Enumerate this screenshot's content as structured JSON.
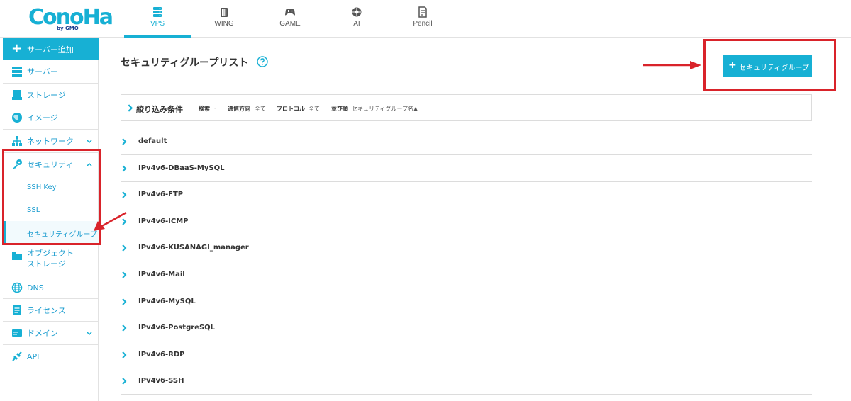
{
  "logo": {
    "text": "ConoHa",
    "sub": "by GMO"
  },
  "tabs": [
    {
      "label": "VPS",
      "icon": "server-icon",
      "active": true
    },
    {
      "label": "WING",
      "icon": "wing-icon",
      "active": false
    },
    {
      "label": "GAME",
      "icon": "gamepad-icon",
      "active": false
    },
    {
      "label": "AI",
      "icon": "ai-icon",
      "active": false
    },
    {
      "label": "Pencil",
      "icon": "pencil-icon",
      "active": false
    }
  ],
  "sidebar": {
    "add_server": "サーバー追加",
    "items": [
      {
        "label": "サーバー",
        "icon": "server-icon"
      },
      {
        "label": "ストレージ",
        "icon": "storage-icon"
      },
      {
        "label": "イメージ",
        "icon": "image-icon"
      },
      {
        "label": "ネットワーク",
        "icon": "network-icon",
        "chevron": "down"
      },
      {
        "label": "セキュリティ",
        "icon": "key-icon",
        "chevron": "up"
      },
      {
        "label": "オブジェクト",
        "label2": "ストレージ",
        "icon": "folder-icon"
      },
      {
        "label": "DNS",
        "icon": "globe-icon"
      },
      {
        "label": "ライセンス",
        "icon": "license-icon"
      },
      {
        "label": "ドメイン",
        "icon": "domain-icon",
        "chevron": "down"
      },
      {
        "label": "API",
        "icon": "api-icon"
      }
    ],
    "security_sub": [
      {
        "label": "SSH Key",
        "active": false
      },
      {
        "label": "SSL",
        "active": false
      },
      {
        "label": "セキュリティグループ",
        "active": true
      }
    ]
  },
  "main": {
    "title": "セキュリティグループリスト",
    "add_button": "セキュリティグループ",
    "filter": {
      "title": "絞り込み条件",
      "search_label": "検索",
      "search_value": "-",
      "direction_label": "通信方向",
      "direction_value": "全て",
      "protocol_label": "プロトコル",
      "protocol_value": "全て",
      "sort_label": "並び順",
      "sort_value": "セキュリティグループ名▲"
    },
    "groups": [
      "default",
      "IPv4v6-DBaaS-MySQL",
      "IPv4v6-FTP",
      "IPv4v6-ICMP",
      "IPv4v6-KUSANAGI_manager",
      "IPv4v6-Mail",
      "IPv4v6-MySQL",
      "IPv4v6-PostgreSQL",
      "IPv4v6-RDP",
      "IPv4v6-SSH"
    ]
  },
  "colors": {
    "accent": "#17b0d4",
    "annotation": "#d9232a",
    "logo_sub": "#1b3f8f"
  }
}
